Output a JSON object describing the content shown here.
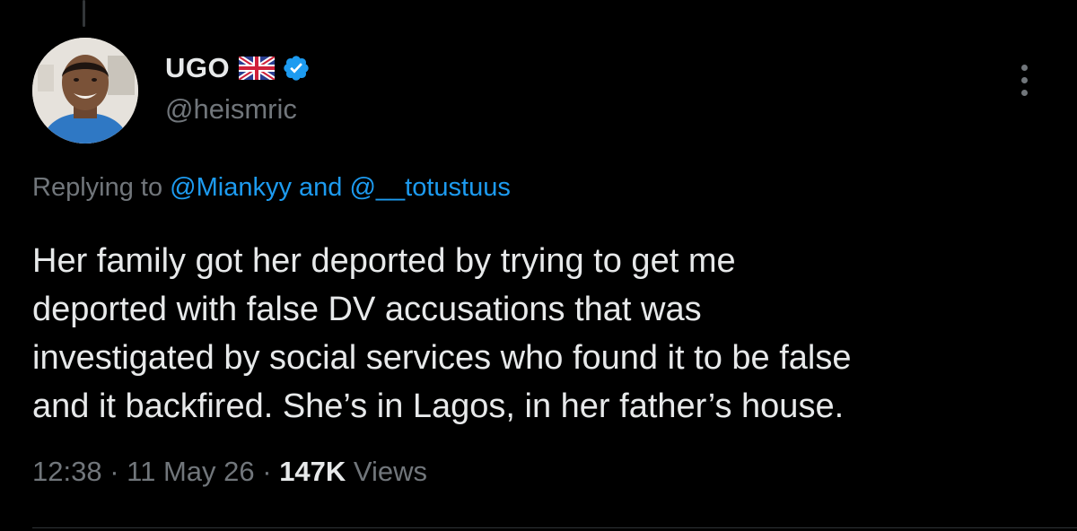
{
  "colors": {
    "background": "#000000",
    "primary_text": "#e7e9ea",
    "secondary_text": "#71767b",
    "link": "#1d9bf0",
    "verified_badge": "#1d9bf0"
  },
  "author": {
    "display_name": "UGO",
    "flag_icon": "uk-flag-icon",
    "verified_icon": "verified-badge-icon",
    "handle": "@heismric"
  },
  "reply": {
    "prefix": "Replying to",
    "mention_1": "@Miankyy",
    "conjunction": "and",
    "mention_2": "@__totustuus"
  },
  "tweet": {
    "lines": [
      "Her family got her deported by trying to get me",
      "deported with false DV accusations that was",
      "investigated by social services who found it to be false",
      "and it backfired. She’s in Lagos, in her father’s house."
    ]
  },
  "meta": {
    "time": "12:38",
    "separator": "·",
    "date": "11 May 26",
    "views_count": "147K",
    "views_label": "Views"
  },
  "more_icon": "more-options-icon"
}
